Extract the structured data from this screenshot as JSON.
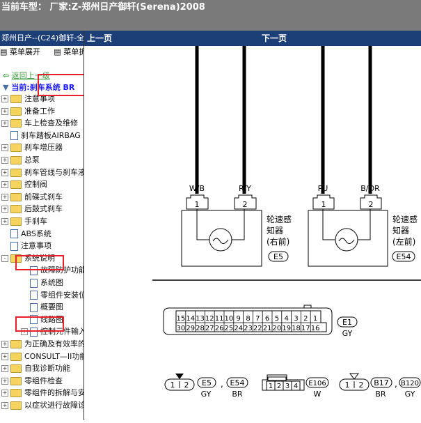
{
  "window": {
    "title": "当前车型： 厂家:Z-郑州日产御轩(Serena)2008"
  },
  "sidebar": {
    "header": "郑州日产--(C24)御轩-全",
    "menu": [
      "菜单展开",
      "菜单折叠"
    ],
    "back_label": "返回上一级",
    "current_label": "当前:刹车系统 BR",
    "items": [
      {
        "label": "注意事项",
        "type": "folder",
        "expand": "+"
      },
      {
        "label": "准备工作",
        "type": "folder",
        "expand": "+"
      },
      {
        "label": "车上检查及维修",
        "type": "folder",
        "expand": "+"
      },
      {
        "label": "刹车踏板AIRBAG",
        "type": "page",
        "expand": ""
      },
      {
        "label": "刹车增压器",
        "type": "folder",
        "expand": "+"
      },
      {
        "label": "总泵",
        "type": "folder",
        "expand": "+"
      },
      {
        "label": "刹车管线与刹车液",
        "type": "folder",
        "expand": "+"
      },
      {
        "label": "控制阀",
        "type": "folder",
        "expand": "+"
      },
      {
        "label": "前碟式刹车",
        "type": "folder",
        "expand": "+"
      },
      {
        "label": "后鼓式刹车",
        "type": "folder",
        "expand": "+"
      },
      {
        "label": "手刹车",
        "type": "folder",
        "expand": "+"
      },
      {
        "label": "ABS系统",
        "type": "page",
        "expand": ""
      },
      {
        "label": "注意事项",
        "type": "page",
        "expand": ""
      },
      {
        "label": "系统说明",
        "type": "folder",
        "expand": "-"
      },
      {
        "label": "故障防护功能",
        "type": "page",
        "expand": "",
        "indent": 1
      },
      {
        "label": "系统图",
        "type": "page",
        "expand": "",
        "indent": 1
      },
      {
        "label": "零组件安装位置",
        "type": "page",
        "expand": "",
        "indent": 1
      },
      {
        "label": "概要图",
        "type": "page",
        "expand": "",
        "indent": 1
      },
      {
        "label": "线路图",
        "type": "page",
        "expand": "",
        "indent": 1
      },
      {
        "label": "控制元件输入",
        "type": "page",
        "expand": "+",
        "indent": 1
      },
      {
        "label": "为正确及有效率的",
        "type": "folder",
        "expand": "+"
      },
      {
        "label": "CONSULT—II功能",
        "type": "folder",
        "expand": "+"
      },
      {
        "label": "自我诊断功能",
        "type": "folder",
        "expand": "+"
      },
      {
        "label": "零组件检查",
        "type": "folder",
        "expand": "+"
      },
      {
        "label": "零组件的拆解与安装",
        "type": "folder",
        "expand": "+"
      },
      {
        "label": "以症状进行故障诊断",
        "type": "folder",
        "expand": "+"
      }
    ]
  },
  "nav": {
    "prev": "上一页",
    "next": "下一页"
  },
  "diagram": {
    "wires": [
      "W/B",
      "R/Y",
      "PU",
      "B/OR"
    ],
    "pins": [
      "1",
      "2",
      "1",
      "2"
    ],
    "sensor_right_lines": [
      "轮速感",
      "知器",
      "(右前)"
    ],
    "sensor_left_lines": [
      "轮速感",
      "知器",
      "(左前)"
    ],
    "sensor_right_code": "E5",
    "sensor_left_code": "E54",
    "connector_main": {
      "row1": [
        "15",
        "14",
        "13",
        "12",
        "11",
        "10",
        "9",
        "8",
        "7",
        "6",
        "5",
        "4",
        "3",
        "2",
        "1"
      ],
      "row2": [
        "30",
        "29",
        "28",
        "27",
        "26",
        "25",
        "24",
        "23",
        "22",
        "21",
        "20",
        "19",
        "18",
        "17",
        "16"
      ],
      "code": "E1",
      "color": "GY"
    },
    "small_conn_a": {
      "pins": [
        "1",
        "2"
      ],
      "codes": [
        "E5",
        "E54"
      ],
      "colors": [
        "GY",
        "BR"
      ]
    },
    "small_conn_b": {
      "pins": [
        "1",
        "2",
        "3",
        "4"
      ],
      "code": "E106",
      "color": "W"
    },
    "small_conn_c": {
      "pins": [
        "1",
        "2"
      ],
      "codes": [
        "B17",
        "B120"
      ],
      "colors": [
        "BR",
        "GY"
      ]
    }
  }
}
